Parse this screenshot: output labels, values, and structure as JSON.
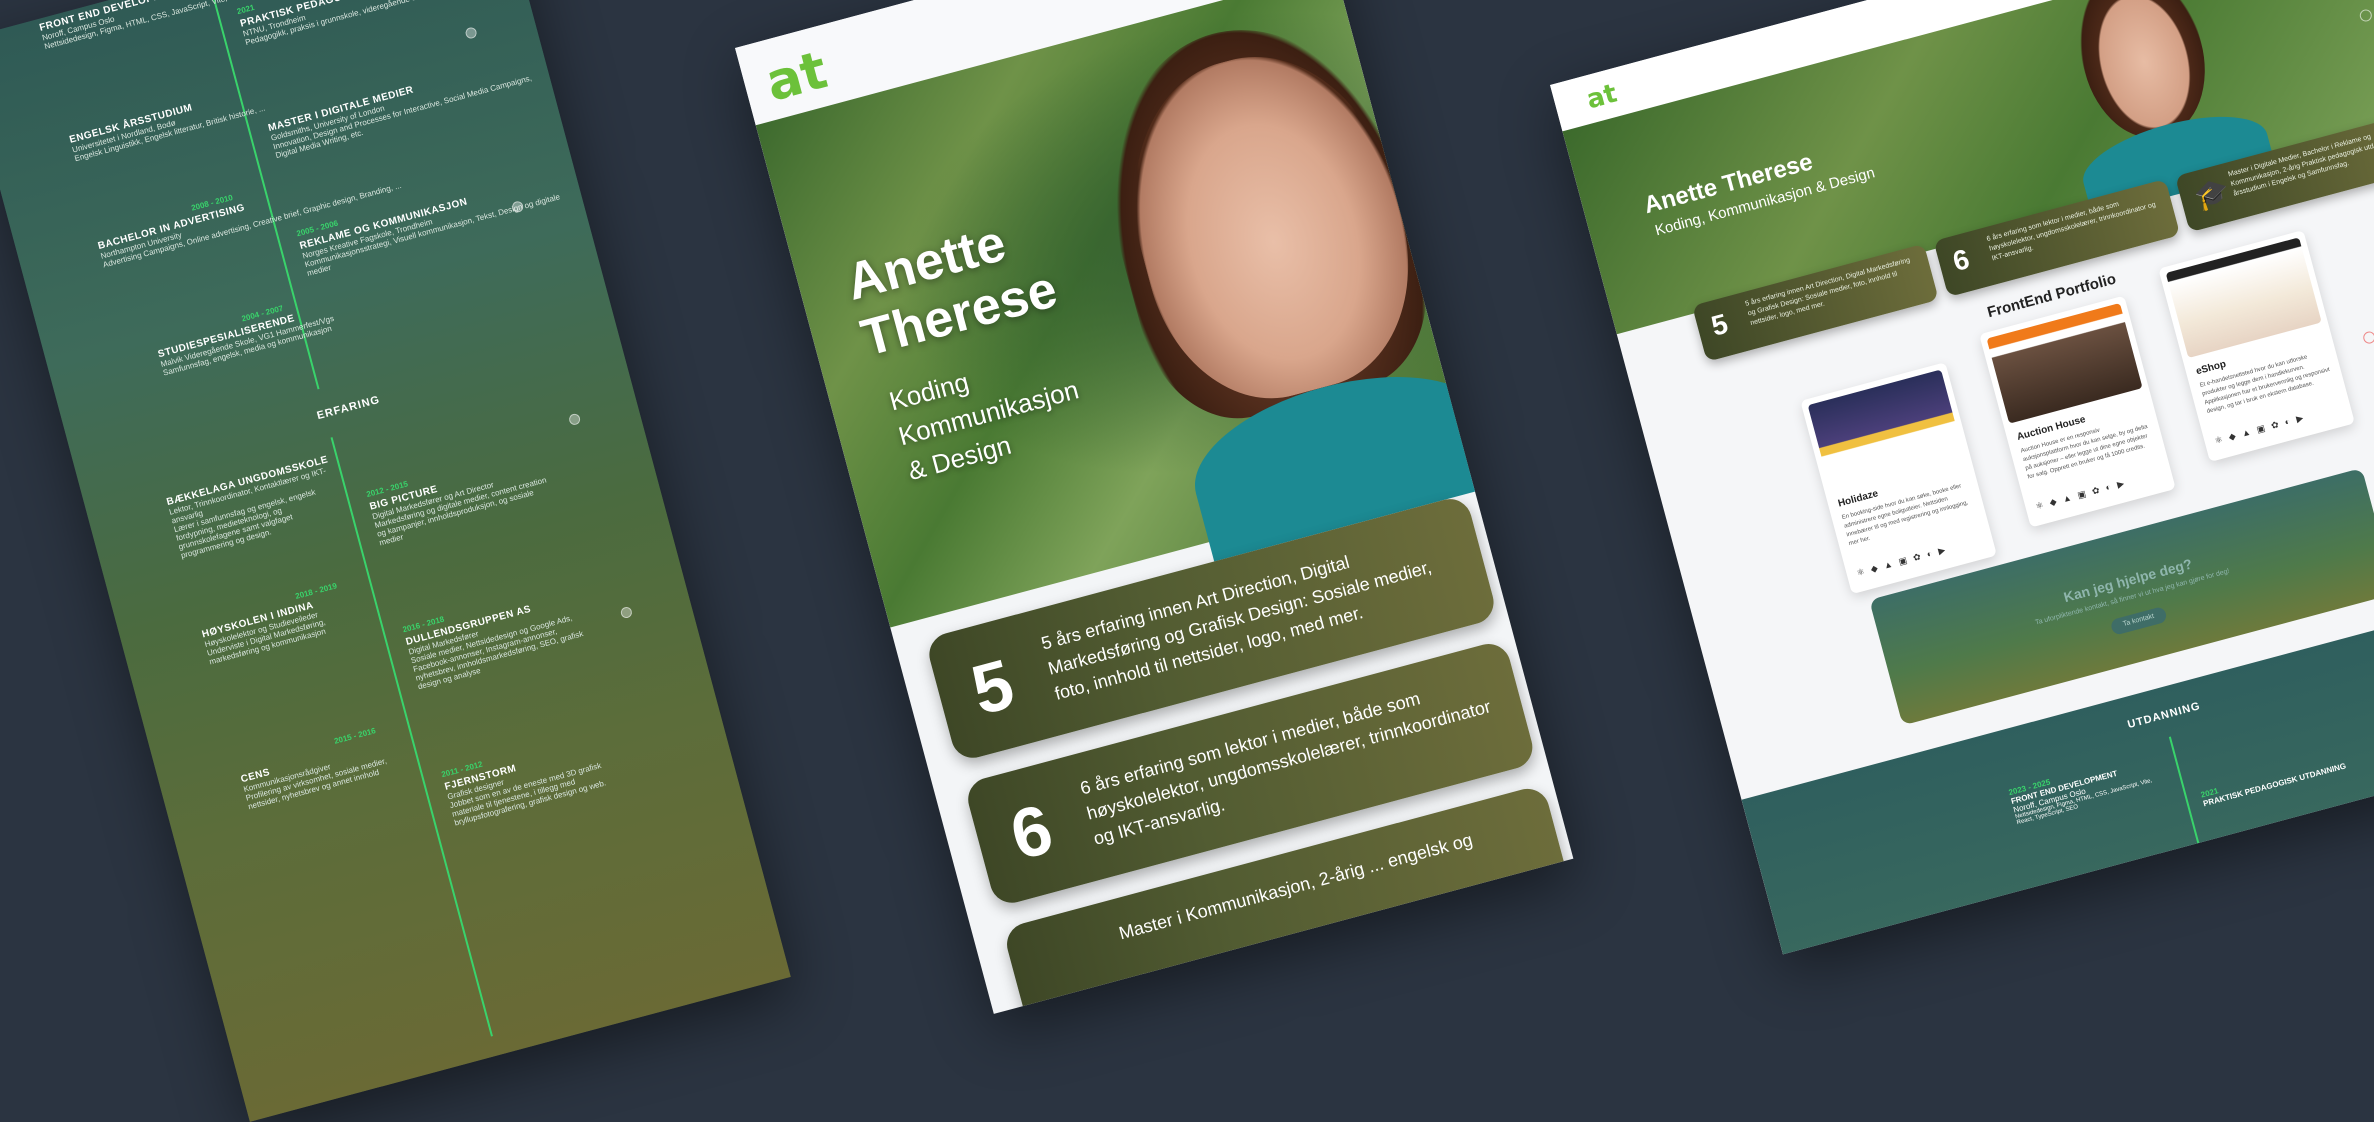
{
  "left": {
    "timeline": [
      {
        "year": "",
        "title": "FRONT END DEVELOPMENT",
        "place": "Noroff, Campus Oslo",
        "desc": "Nettsidedesign, Figma, HTML, CSS, JavaScript, Vite, React, TypeScript, SEO"
      },
      {
        "year": "2021",
        "title": "PRAKTISK PEDAGOGISK UTDANNING",
        "place": "NTNU, Trondheim",
        "desc": "Pedagogikk, praksis i grunnskole, videregående skole og praktiskpedagogisk, ..."
      },
      {
        "year": "",
        "title": "ENGELSK ÅRSSTUDIUM",
        "place": "Universitetet i Nordland, Bodø",
        "desc": "Engelsk Linguistikk, Engelsk litteratur, Britisk historie, ..."
      },
      {
        "year": "",
        "title": "MASTER I DIGITALE MEDIER",
        "place": "Goldsmiths, University of London",
        "desc": "Innovation, Design and Processes for Interactive, Social Media Campaigns, Digital Media Writing, etc."
      },
      {
        "year": "2008 - 2010",
        "title": "BACHELOR IN ADVERTISING",
        "place": "Northampton University",
        "desc": "Advertising Campaigns, Online advertising, Creative brief, Graphic design, Branding, ..."
      },
      {
        "year": "2005 - 2006",
        "title": "REKLAME OG KOMMUNIKASJON",
        "place": "Norges Kreative Fagskole, Trondheim",
        "desc": "Kommunikasjonsstrategi, Visuell kommunikasjon, Tekst, Design og digitale medier"
      },
      {
        "year": "2004 - 2007",
        "title": "STUDIESPESIALISERENDE",
        "place": "Malvik Videregående Skole, VG1 Hammerfest/Vgs",
        "desc": "Samfunnsfag, engelsk, media og kommunikasjon"
      }
    ],
    "erfaring_title": "ERFARING",
    "experience": [
      {
        "year": "",
        "title": "BÆKKELAGA UNGDOMSSKOLE",
        "place": "Lektor, Trinnkoordinator, Kontaktlærer og IKT-ansvarlig",
        "desc": "Lærer i samfunnsfag og engelsk, engelsk fordypning, medieteknologi, og grunnskolefagene samt valgfaget programmering og design."
      },
      {
        "year": "2012 - 2015",
        "title": "BIG PICTURE",
        "place": "Digital Markedsfører og Art Director",
        "desc": "Markedsføring og digitale medier, content creation og kampanjer, innholdsproduksjon, og sosiale medier"
      },
      {
        "year": "2018 - 2019",
        "title": "HØYSKOLEN I INDINA",
        "place": "Høyskolelektor og Studieveileder",
        "desc": "Underviste i Digital Markedsføring, markedsføring og kommunikasjon"
      },
      {
        "year": "2016 - 2018",
        "title": "DULLENDSGRUPPEN AS",
        "place": "Digital Markedsfører",
        "desc": "Sosiale medier, Nettsidedesign og Google Ads, Facebook-annonser, Instagram-annonser, nyhetsbrev, innholdsmarkedsføring, SEO, grafisk design og analyse"
      },
      {
        "year": "2015 - 2016",
        "title": "CENS",
        "place": "Kommunikasjonsrådgiver",
        "desc": "Profilering av virksomhet, sosiale medier, nettsider, nyhetsbrev og annet innhold"
      },
      {
        "year": "2011 - 2012",
        "title": "FJERNSTORM",
        "place": "Grafisk designer",
        "desc": "Jobbet som en av de eneste med 3D grafisk materiale til tjenestene, i tillegg med bryllupsfotografering, grafisk design og web."
      }
    ]
  },
  "middle": {
    "logo": "at",
    "name_line1": "Anette",
    "name_line2": "Therese",
    "sub_line1": "Koding",
    "sub_line2": "Kommunikasjon",
    "sub_line3": "& Design",
    "stats": [
      {
        "num": "5",
        "text": "5 års erfaring innen Art Direction, Digital Markedsføring og Grafisk Design: Sosiale medier, foto, innhold til nettsider, logo, med mer."
      },
      {
        "num": "6",
        "text": "6 års erfaring som lektor i medier, både som høyskolelektor, ungdomsskolelærer, trinnkoordinator og IKT-ansvarlig."
      },
      {
        "num": "",
        "text": "Master i Kommunikasjon, 2-årig ... engelsk og"
      }
    ]
  },
  "right": {
    "logo": "at",
    "name": "Anette Therese",
    "sub": "Koding, Kommunikasjon & Design",
    "stats": [
      {
        "num": "5",
        "text": "5 års erfaring innen Art Direction, Digital Markedsføring og Grafisk Design: Sosiale medier, foto, innhold til nettsider, logo, med mer."
      },
      {
        "num": "6",
        "text": "6 års erfaring som lektor i medier, både som høyskolelektor, ungdomsskolelærer, trinnkoordinator og IKT-ansvarlig."
      },
      {
        "num": "",
        "text": "Master i Digitale Medier, Bachelor i Reklame og Kommunikasjon, 2-årig Praktisk pedagogisk utdanning og årsstudium i Engelsk og Samfunnsfag."
      }
    ],
    "portfolio_title": "FrontEnd Portfolio",
    "projects": [
      {
        "title": "Holidaze",
        "desc": "En booking-side hvor du kan søke, booke eller administrere egne boligutleier. Nettsiden innebærer til og med registrering og innlogging, mer her.",
        "icons": "⚛ ◆ ▲ ▣ ✿ ◐ ▶"
      },
      {
        "title": "Auction House",
        "desc": "Auction House er en responsiv auksjonsplattform hvor du kan selge, by og delta på auksjoner – eller legge ut dine egne objekter for salg. Opprett en bruker og få 1000 credits.",
        "icons": "⚛ ◆ ▲ ▣ ✿ ◐ ▶"
      },
      {
        "title": "eShop",
        "desc": "Et e-handelsnettsted hvor du kan utforske produkter og legge dem i handlekurven. Applikasjonen har et brukervennlig og responsivt design, og tar i bruk en ekstern database.",
        "icons": "⚛ ◆ ▲ ▣ ✿ ◐ ▶"
      }
    ],
    "help_title": "Kan jeg hjelpe deg?",
    "help_text": "Ta uforpliktende kontakt, så finner vi ut hva jeg kan gjøre for deg!",
    "help_button": "Ta kontakt",
    "edu_title": "UTDANNING",
    "edu_items": [
      {
        "year": "2023 - 2025",
        "title": "FRONT END DEVELOPMENT",
        "place": "Noroff, Campus Oslo",
        "desc": "Nettsidedesign, Figma, HTML, CSS, JavaScript, Vite, React, TypeScript, SEO"
      },
      {
        "year": "2021",
        "title": "PRAKTISK PEDAGOGISK UTDANNING",
        "place": "",
        "desc": ""
      }
    ]
  },
  "colors": {
    "background": "#2b3441",
    "accent": "#39d36b",
    "logo": "#6cc13a",
    "teal": "#1c8a93"
  }
}
